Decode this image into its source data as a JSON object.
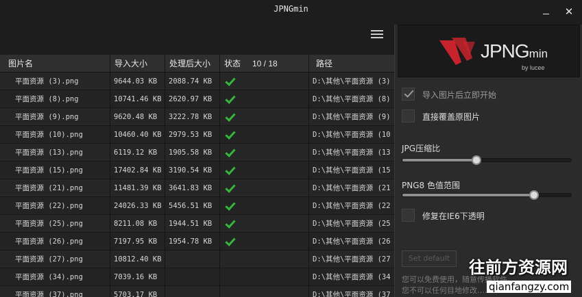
{
  "window": {
    "title": "JPNGmin",
    "minimize_icon": "minimize-icon",
    "close_symbol": "✕"
  },
  "table": {
    "headers": {
      "name": "图片名",
      "input_size": "导入大小",
      "output_size": "处理后大小",
      "status": "状态",
      "count": "10 / 18",
      "path": "路径"
    },
    "rows": [
      {
        "name": "平面资源 (3).png",
        "input": "9644.03 KB",
        "output": "2088.74 KB",
        "done": true,
        "path": "D:\\其他\\平面资源 (3)"
      },
      {
        "name": "平面资源 (8).png",
        "input": "10741.46 KB",
        "output": "2620.97 KB",
        "done": true,
        "path": "D:\\其他\\平面资源 (8)"
      },
      {
        "name": "平面资源 (9).png",
        "input": "9620.48 KB",
        "output": "3222.78 KB",
        "done": true,
        "path": "D:\\其他\\平面资源 (9)"
      },
      {
        "name": "平面资源 (10).png",
        "input": "10460.40 KB",
        "output": "2979.53 KB",
        "done": true,
        "path": "D:\\其他\\平面资源 (10"
      },
      {
        "name": "平面资源 (13).png",
        "input": "6119.12 KB",
        "output": "1905.58 KB",
        "done": true,
        "path": "D:\\其他\\平面资源 (13"
      },
      {
        "name": "平面资源 (15).png",
        "input": "17402.84 KB",
        "output": "3190.54 KB",
        "done": true,
        "path": "D:\\其他\\平面资源 (15"
      },
      {
        "name": "平面资源 (21).png",
        "input": "11481.39 KB",
        "output": "3641.83 KB",
        "done": true,
        "path": "D:\\其他\\平面资源 (21"
      },
      {
        "name": "平面资源 (22).png",
        "input": "24026.33 KB",
        "output": "5456.51 KB",
        "done": true,
        "path": "D:\\其他\\平面资源 (22"
      },
      {
        "name": "平面资源 (25).png",
        "input": "8211.08 KB",
        "output": "1944.51 KB",
        "done": true,
        "path": "D:\\其他\\平面资源 (25"
      },
      {
        "name": "平面资源 (26).png",
        "input": "7197.95 KB",
        "output": "1954.78 KB",
        "done": true,
        "path": "D:\\其他\\平面资源 (26"
      },
      {
        "name": "平面资源 (27).png",
        "input": "10812.40 KB",
        "output": "",
        "done": false,
        "path": "D:\\其他\\平面资源 (27"
      },
      {
        "name": "平面资源 (34).png",
        "input": "7039.16 KB",
        "output": "",
        "done": false,
        "path": "D:\\其他\\平面资源 (34"
      },
      {
        "name": "平面资源 (37).png",
        "input": "5703.17 KB",
        "output": "",
        "done": false,
        "path": "D:\\其他\\平面资源 (37"
      }
    ]
  },
  "panel": {
    "logo_text": "JPNG",
    "logo_suffix": "min",
    "logo_by": "by lucee",
    "brand_color": "#c8232c",
    "options": {
      "auto_start": {
        "label": "导入图片后立即开始",
        "checked": true,
        "disabled": true
      },
      "overwrite": {
        "label": "直接覆盖原图片",
        "checked": false
      },
      "ie6_fix": {
        "label": "修复在IE6下透明",
        "checked": false
      }
    },
    "jpg_slider": {
      "label": "JPG压缩比",
      "value_fraction": 0.44
    },
    "png_slider": {
      "label": "PNG8 色值范围",
      "value_fraction": 0.78
    },
    "reset_label": "Set default",
    "note_line1": "您可以免费使用，随意传播软件。",
    "note_line2": "您不可以任何目地修改……"
  },
  "watermark": {
    "line1": "往前方资源网",
    "line2": "qianfangzy.com"
  }
}
